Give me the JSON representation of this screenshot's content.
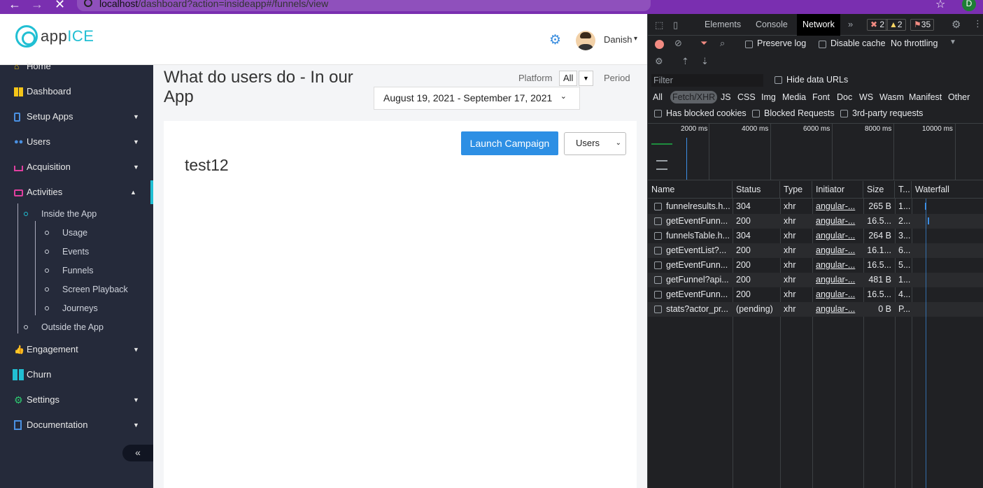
{
  "browser": {
    "back": "←",
    "forward": "→",
    "stop": "✕",
    "url_host": "localhost",
    "url_path": "/dashboard?action=insideapp#/funnels/view",
    "star": "☆",
    "profile_initial": "D"
  },
  "header": {
    "logo_app": "app",
    "logo_ice": "ICE",
    "user_name": "Danish",
    "caret": "▾"
  },
  "sidebar": {
    "items": [
      {
        "label": "Home",
        "icon": "home-icon"
      },
      {
        "label": "Dashboard",
        "icon": "dashboard-icon"
      },
      {
        "label": "Setup Apps",
        "icon": "setup-apps-icon",
        "arrow": "▼"
      },
      {
        "label": "Users",
        "icon": "users-icon",
        "arrow": "▼"
      },
      {
        "label": "Acquisition",
        "icon": "acquisition-icon",
        "arrow": "▼"
      },
      {
        "label": "Activities",
        "icon": "activities-icon",
        "arrow": "▲"
      },
      {
        "label": "Engagement",
        "icon": "engagement-icon",
        "arrow": "▼"
      },
      {
        "label": "Churn",
        "icon": "churn-icon"
      },
      {
        "label": "Settings",
        "icon": "settings-icon",
        "arrow": "▼"
      },
      {
        "label": "Documentation",
        "icon": "documentation-icon",
        "arrow": "▼"
      }
    ],
    "sub": {
      "inside": "Inside the App",
      "usage": "Usage",
      "events": "Events",
      "funnels": "Funnels",
      "playback": "Screen Playback",
      "journeys": "Journeys",
      "outside": "Outside the App"
    },
    "collapse": "«"
  },
  "main": {
    "title": "What do users do - In our App",
    "platform_label": "Platform",
    "platform_value": "All",
    "period_label": "Period",
    "date_range": "August 19, 2021 - September 17, 2021",
    "launch_button": "Launch Campaign",
    "users_select": "Users",
    "funnel_name": "test12"
  },
  "devtools": {
    "tabs": [
      "Elements",
      "Console",
      "Network"
    ],
    "active_tab": "Network",
    "more": "»",
    "errors": "2",
    "warnings": "2",
    "issues": "35",
    "preserve_log": "Preserve log",
    "disable_cache": "Disable cache",
    "throttling": "No throttling",
    "filter_placeholder": "Filter",
    "hide_data_urls": "Hide data URLs",
    "types": [
      "All",
      "Fetch/XHR",
      "JS",
      "CSS",
      "Img",
      "Media",
      "Font",
      "Doc",
      "WS",
      "Wasm",
      "Manifest",
      "Other"
    ],
    "has_blocked_cookies": "Has blocked cookies",
    "blocked_requests": "Blocked Requests",
    "third_party": "3rd-party requests",
    "overview_ticks": [
      "2000 ms",
      "4000 ms",
      "6000 ms",
      "8000 ms",
      "10000 ms"
    ],
    "columns": [
      "Name",
      "Status",
      "Type",
      "Initiator",
      "Size",
      "T...",
      "Waterfall"
    ],
    "rows": [
      {
        "name": "funnelresults.h...",
        "status": "304",
        "type": "xhr",
        "initiator": "angular-...",
        "size": "265 B",
        "time": "1..."
      },
      {
        "name": "getEventFunn...",
        "status": "200",
        "type": "xhr",
        "initiator": "angular-...",
        "size": "16.5...",
        "time": "2..."
      },
      {
        "name": "funnelsTable.h...",
        "status": "304",
        "type": "xhr",
        "initiator": "angular-...",
        "size": "264 B",
        "time": "3..."
      },
      {
        "name": "getEventList?...",
        "status": "200",
        "type": "xhr",
        "initiator": "angular-...",
        "size": "16.1...",
        "time": "6..."
      },
      {
        "name": "getEventFunn...",
        "status": "200",
        "type": "xhr",
        "initiator": "angular-...",
        "size": "16.5...",
        "time": "5..."
      },
      {
        "name": "getFunnel?api...",
        "status": "200",
        "type": "xhr",
        "initiator": "angular-...",
        "size": "481 B",
        "time": "1..."
      },
      {
        "name": "getEventFunn...",
        "status": "200",
        "type": "xhr",
        "initiator": "angular-...",
        "size": "16.5...",
        "time": "4..."
      },
      {
        "name": "stats?actor_pr...",
        "status": "(pending)",
        "type": "xhr",
        "initiator": "angular-...",
        "size": "0 B",
        "time": "P..."
      }
    ]
  }
}
